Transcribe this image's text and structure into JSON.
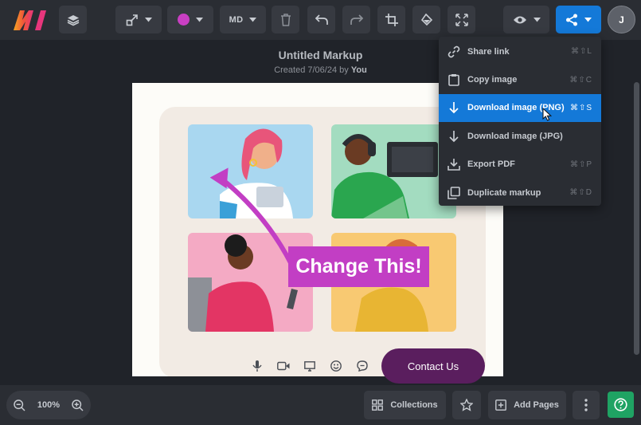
{
  "toolbar": {
    "size_label": "MD",
    "color": "#c93fc3",
    "avatar_initial": "J"
  },
  "document": {
    "title": "Untitled Markup",
    "created_prefix": "Created 7/06/24 by",
    "created_by": "You"
  },
  "artwork": {
    "callout_text": "Change This!",
    "contact_label": "Contact Us"
  },
  "share_menu": {
    "items": [
      {
        "label": "Share link",
        "shortcut": "⌘⇧L",
        "icon": "link-icon"
      },
      {
        "label": "Copy image",
        "shortcut": "⌘⇧C",
        "icon": "clipboard-icon"
      },
      {
        "label": "Download image (PNG)",
        "shortcut": "⌘⇧S",
        "icon": "download-icon",
        "highlighted": true
      },
      {
        "label": "Download image (JPG)",
        "shortcut": "",
        "icon": "download-icon"
      },
      {
        "label": "Export PDF",
        "shortcut": "⌘⇧P",
        "icon": "export-icon"
      },
      {
        "label": "Duplicate markup",
        "shortcut": "⌘⇧D",
        "icon": "duplicate-icon"
      }
    ]
  },
  "bottom": {
    "zoom": "100%",
    "collections_label": "Collections",
    "add_pages_label": "Add Pages"
  },
  "colors": {
    "accent": "#1479d8",
    "help": "#1fa363",
    "callout": "#c23ec4"
  }
}
